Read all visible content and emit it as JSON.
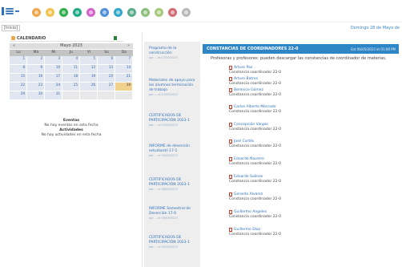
{
  "colors": {
    "accent": "#2f86c6",
    "topbar_circles": [
      "#f0a64a",
      "#f2c14e",
      "#2faf49",
      "#1faa86",
      "#d263c8",
      "#4f8fd9",
      "#32a7c9",
      "#59ad8c",
      "#8fbf7d",
      "#a6c97a",
      "#d06b74",
      "#b9b9b9"
    ]
  },
  "icons": {
    "menu": "menu-icon",
    "calendar": "calendar-icon",
    "excel": "spreadsheet-icon",
    "pdf": "pdf-icon"
  },
  "breadcrumb": "[Inicio]",
  "date_text": "Domingo 28 de Mayo de",
  "calendar": {
    "label": "CALENDARIO",
    "prev": "«",
    "next": "»",
    "month": "Mayo 2023",
    "dow": [
      "Lu",
      "Ma",
      "Mi",
      "Ju",
      "Vi",
      "Sa",
      "Do"
    ],
    "weeks": [
      [
        "1",
        "2",
        "3",
        "4",
        "5",
        "6",
        "7"
      ],
      [
        "8",
        "9",
        "10",
        "11",
        "12",
        "13",
        "14"
      ],
      [
        "15",
        "16",
        "17",
        "18",
        "19",
        "20",
        "21"
      ],
      [
        "22",
        "23",
        "24",
        "25",
        "26",
        "27",
        "28"
      ],
      [
        "29",
        "30",
        "31",
        "",
        "",
        "",
        ""
      ]
    ],
    "agenda_events_heading": "Eventos",
    "agenda_events_text": "No hay eventos en esta fecha",
    "agenda_activities_heading": "Actividades",
    "agenda_activities_text": "No hay actividades en esta fecha"
  },
  "news": [
    {
      "title": "Programa de la construcción",
      "meta": "por ... el 17/05/2023"
    },
    {
      "title": "Materiales de apoyo para los alumnos terminación de trabajo",
      "meta": "por ... el 17/05/2023"
    },
    {
      "title": "CERTIFICADOS DE PARTICIPACIÓN 2023-1",
      "meta": "por ... el 12/05/2023"
    },
    {
      "title": "INFORME de deserción estudiantil 17-1",
      "meta": "por ... el 10/05/2023"
    },
    {
      "title": "CERTIFICADOS DE PARTICIPACIÓN 2023-1",
      "meta": "por ... el 08/05/2023"
    },
    {
      "title": "INFORME Semestral de Deserción 17-0",
      "meta": "por ... el 05/05/2023"
    },
    {
      "title": "CERTIFICADOS DE PARTICIPACIÓN 2023-1",
      "meta": "por ... el 02/05/2023"
    }
  ],
  "panel": {
    "title": "CONSTANCIAS DE COORDINADORES 22-0",
    "timestamp": "Sat 06/05/2023 at 01:08 PM",
    "intro": "Profesoras y profesores: pueden descargar las constancias de coordinador de materias.",
    "docs": [
      {
        "who": "Arturo Paz",
        "what": "Constancia coordinador 22-0"
      },
      {
        "who": "Arturo Batres",
        "what": "Constancia coordinador 22-0"
      },
      {
        "who": "Berenice Gómez",
        "what": "Constancia coordinador 22-0"
      },
      {
        "who": "Carlos Alberto Mercado",
        "what": "Constancia coordinador 22-0"
      },
      {
        "who": "Concepción Vargas",
        "what": "Constancia coordinador 22-0"
      },
      {
        "who": "José Cortés",
        "what": "Constancia coordinador 22-0"
      },
      {
        "who": "Eduardo Navarro",
        "what": "Constancia coordinador 22-0"
      },
      {
        "who": "Eduardo Salinas",
        "what": "Constancia coordinador 22-0"
      },
      {
        "who": "Gerardo Alvarez",
        "what": "Constancia coordinador 22-0"
      },
      {
        "who": "Guillermo Angeles",
        "what": "Constancia coordinador 22-0"
      },
      {
        "who": "Guillermo Díaz",
        "what": "Constancia coordinador 22-0"
      }
    ]
  }
}
